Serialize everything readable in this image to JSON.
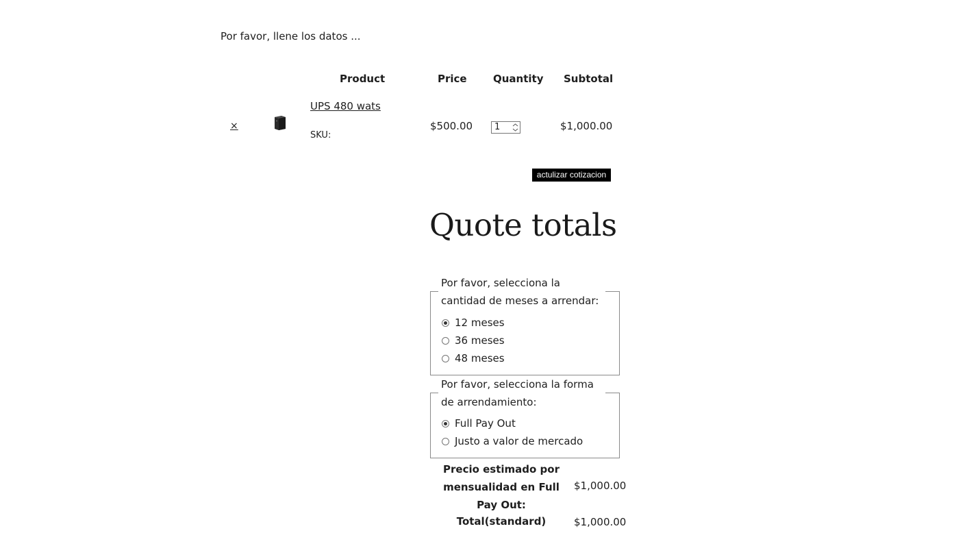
{
  "intro_text": "Por favor, llene los datos ...",
  "table": {
    "headers": {
      "product": "Product",
      "price": "Price",
      "quantity": "Quantity",
      "subtotal": "Subtotal"
    },
    "rows": [
      {
        "remove_symbol": "×",
        "product_name": "UPS 480 wats",
        "sku_label": "SKU:",
        "price": "$500.00",
        "quantity": "1",
        "subtotal": "$1,000.00"
      }
    ]
  },
  "update_button_label": "actulizar cotizacion",
  "quote_totals": {
    "title": "Quote totals",
    "months_group": {
      "legend": "Por favor, selecciona la cantidad de meses a arrendar:",
      "options": [
        {
          "label": "12 meses",
          "checked": true
        },
        {
          "label": "36 meses",
          "checked": false
        },
        {
          "label": "48 meses",
          "checked": false
        }
      ]
    },
    "lease_group": {
      "legend": "Por favor, selecciona la forma de arrendamiento:",
      "options": [
        {
          "label": "Full Pay Out",
          "checked": true
        },
        {
          "label": "Justo a valor de mercado",
          "checked": false
        }
      ]
    },
    "estimate_label": "Precio estimado por mensualidad en Full Pay Out:",
    "estimate_value": "$1,000.00",
    "total_label": "Total(standard)",
    "total_value": "$1,000.00"
  },
  "icons": {
    "remove": "close-icon",
    "thumbnail": "ups-product-image",
    "spinner": "number-spinner-icon"
  },
  "colors": {
    "button_bg": "#000000",
    "button_text": "#ffffff",
    "text": "#1e1e1e",
    "border": "#8a8a8a"
  }
}
